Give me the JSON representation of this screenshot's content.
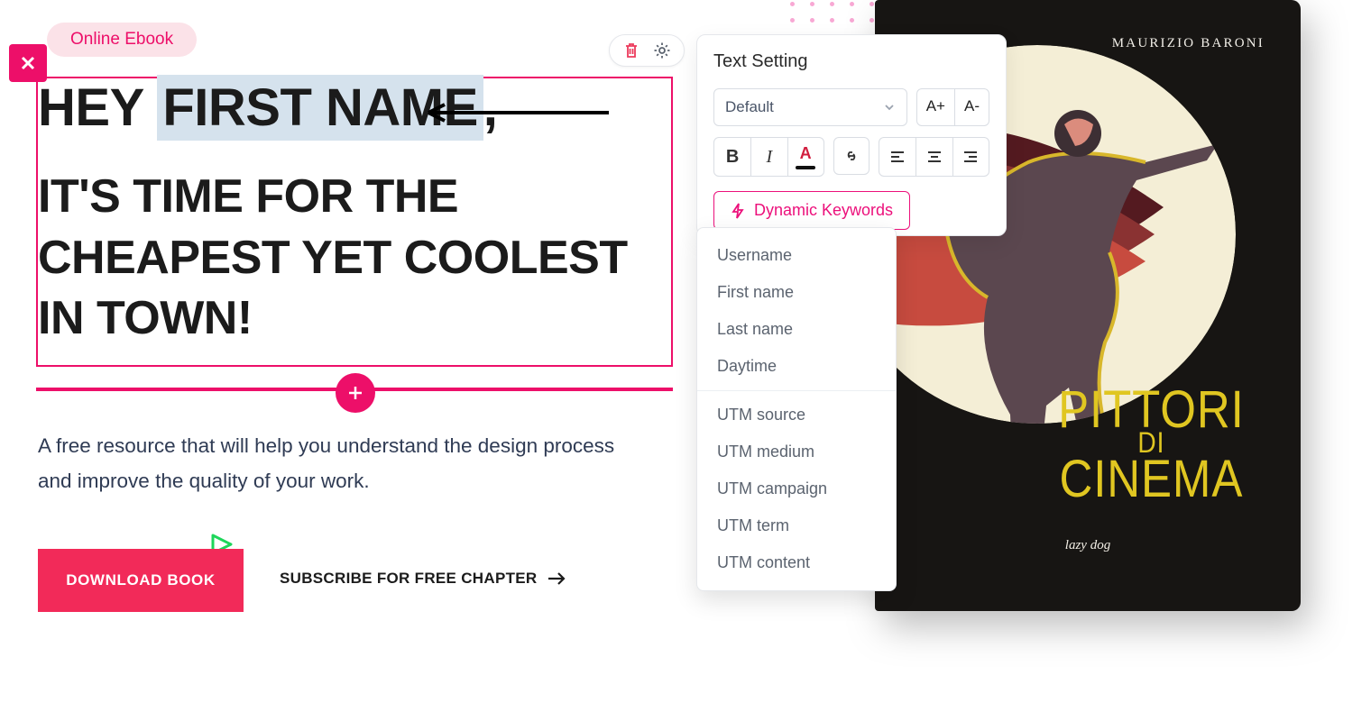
{
  "tag": "Online Ebook",
  "heading": {
    "line1_prefix": "HEY ",
    "highlighted": "FIRST NAME",
    "line1_suffix": ",",
    "line2": "IT'S TIME FOR THE CHEAPEST YET COOLEST IN TOWN!"
  },
  "paragraph": "A free resource that will help you understand the design process and improve the quality of your work.",
  "primary_button": "DOWNLOAD BOOK",
  "secondary_button": "SUBSCRIBE FOR FREE CHAPTER",
  "panel": {
    "title": "Text Setting",
    "font_select": "Default",
    "size_up": "A+",
    "size_down": "A-",
    "bold": "B",
    "italic": "I",
    "keywords_button": "Dynamic Keywords"
  },
  "keywords_group_1": [
    "Username",
    "First name",
    "Last name",
    "Daytime"
  ],
  "keywords_group_2": [
    "UTM source",
    "UTM medium",
    "UTM campaign",
    "UTM term",
    "UTM content"
  ],
  "book": {
    "author": "MAURIZIO BARONI",
    "title_line1": "PITTORI",
    "title_mid": "DI",
    "title_line2": "CINEMA",
    "publisher": "lazy dog"
  }
}
